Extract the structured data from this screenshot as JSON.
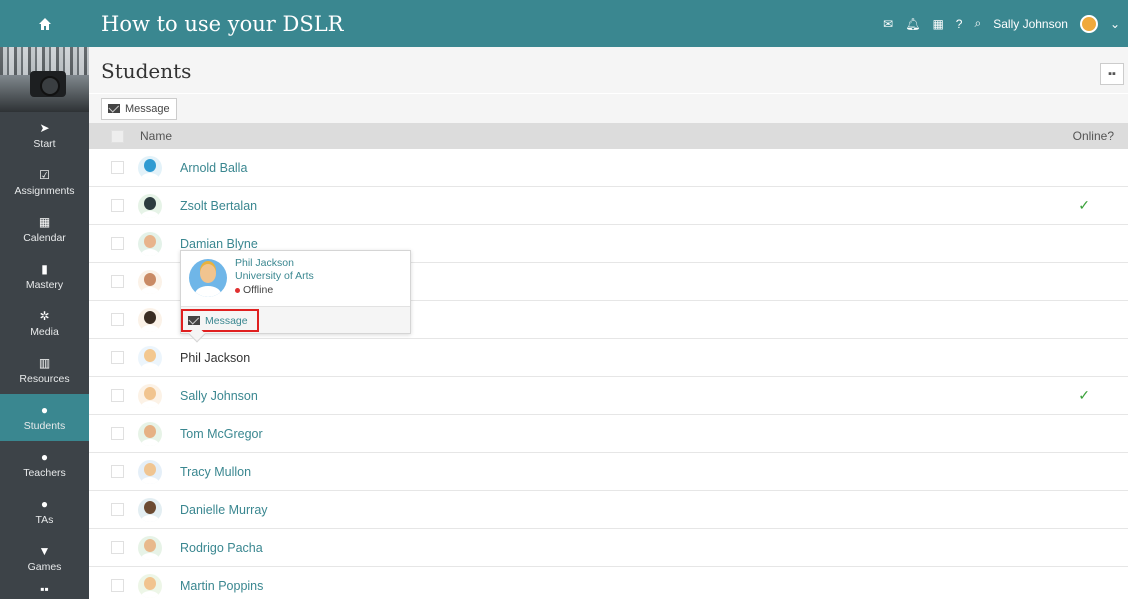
{
  "app": {
    "course_title": "How to use your DSLR",
    "accent": "#3a8790"
  },
  "topbar": {
    "icons": [
      "envelope-icon",
      "bell-icon",
      "calendar-icon",
      "help-icon",
      "search-icon"
    ],
    "user_name": "Sally Johnson"
  },
  "sidebar": {
    "items": [
      {
        "label": "Start",
        "icon": "➤"
      },
      {
        "label": "Assignments",
        "icon": "☑"
      },
      {
        "label": "Calendar",
        "icon": "▦"
      },
      {
        "label": "Mastery",
        "icon": "▮"
      },
      {
        "label": "Media",
        "icon": "✲"
      },
      {
        "label": "Resources",
        "icon": "▥"
      },
      {
        "label": "Students",
        "icon": "●"
      },
      {
        "label": "Teachers",
        "icon": "●"
      },
      {
        "label": "TAs",
        "icon": "●"
      },
      {
        "label": "Games",
        "icon": "▼"
      }
    ]
  },
  "page": {
    "title": "Students",
    "message_button": "Message",
    "col_name": "Name",
    "col_online": "Online?"
  },
  "students": [
    {
      "name": "Arnold Balla",
      "online": false
    },
    {
      "name": "Zsolt Bertalan",
      "online": true
    },
    {
      "name": "Damian Blyne",
      "online": false
    },
    {
      "name": "",
      "online": false
    },
    {
      "name": "",
      "online": false
    },
    {
      "name": "Phil Jackson",
      "online": false
    },
    {
      "name": "Sally Johnson",
      "online": true
    },
    {
      "name": "Tom McGregor",
      "online": false
    },
    {
      "name": "Tracy Mullon",
      "online": false
    },
    {
      "name": "Danielle Murray",
      "online": false
    },
    {
      "name": "Rodrigo Pacha",
      "online": false
    },
    {
      "name": "Martin Poppins",
      "online": false
    }
  ],
  "popup": {
    "name": "Phil Jackson",
    "subtitle": "University of Arts",
    "status": "Offline",
    "message": "Message"
  },
  "check_mark": "✓"
}
